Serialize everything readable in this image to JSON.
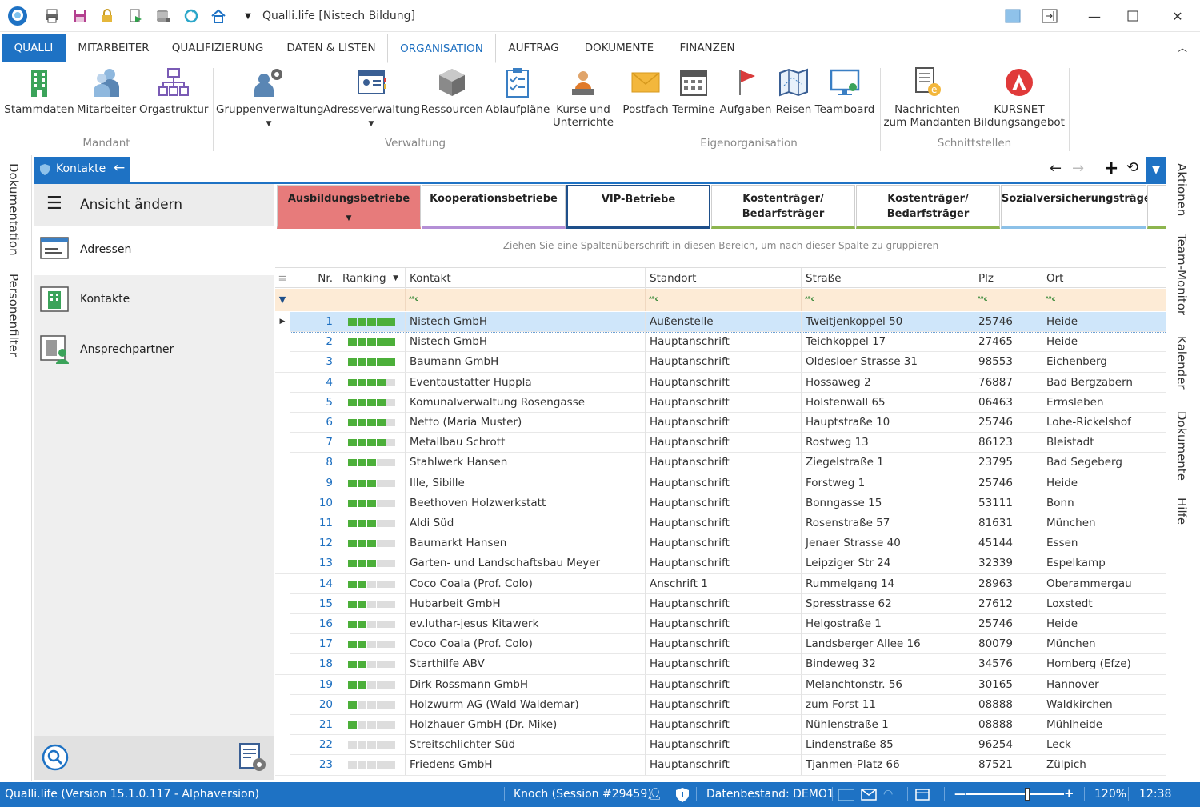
{
  "app": {
    "title": "Qualli.life [Nistech Bildung]"
  },
  "ribbon_tabs": [
    "QUALLI",
    "MITARBEITER",
    "QUALIFIZIERUNG",
    "DATEN & LISTEN",
    "ORGANISATION",
    "AUFTRAG",
    "DOKUMENTE",
    "FINANZEN"
  ],
  "ribbon": {
    "buttons": [
      {
        "label": "Stammdaten",
        "icon": "building-icon"
      },
      {
        "label": "Mitarbeiter",
        "icon": "employees-icon"
      },
      {
        "label": "Orgastruktur",
        "icon": "org-chart-icon"
      },
      {
        "label": "Gruppenverwaltung",
        "icon": "group-gear-icon"
      },
      {
        "label": "Adressverwaltung",
        "icon": "address-book-icon"
      },
      {
        "label": "Ressourcen",
        "icon": "cube-icon"
      },
      {
        "label": "Ablaufpläne",
        "icon": "checklist-icon"
      },
      {
        "label": "Kurse und Unterrichte",
        "icon": "teacher-icon"
      },
      {
        "label": "Postfach",
        "icon": "envelope-icon"
      },
      {
        "label": "Termine",
        "icon": "calendar-icon"
      },
      {
        "label": "Aufgaben",
        "icon": "flag-icon"
      },
      {
        "label": "Reisen",
        "icon": "map-icon"
      },
      {
        "label": "Teamboard",
        "icon": "monitor-icon"
      },
      {
        "label": "Nachrichten zum Mandanten",
        "icon": "message-doc-icon"
      },
      {
        "label": "KURSNET Bildungsangebot",
        "icon": "arbeitsagentur-icon"
      }
    ],
    "groups": [
      "Mandant",
      "Verwaltung",
      "Eigenorganisation",
      "Schnittstellen"
    ]
  },
  "side_left": [
    "Dokumentation",
    "Personenfilter"
  ],
  "side_right": [
    "Aktionen",
    "Team-Monitor",
    "Kalender",
    "Dokumente",
    "Hilfe"
  ],
  "doc_tab": {
    "label": "Kontakte"
  },
  "nav": {
    "title": "Ansicht ändern",
    "items": [
      "Adressen",
      "Kontakte",
      "Ansprechpartner"
    ]
  },
  "tiles": [
    {
      "label": "Ausbildungsbetriebe",
      "color": "#e77b7b",
      "bar": "#e77b7b"
    },
    {
      "label": "Kooperationsbetriebe",
      "color": "#ffffff",
      "bar": "#b48fd6"
    },
    {
      "label": "VIP-Betriebe",
      "color": "#ffffff",
      "bar": "#1e4f8a"
    },
    {
      "label": "Kostenträger/ Bedarfsträger",
      "color": "#ffffff",
      "bar": "#8db54e"
    },
    {
      "label": "Kostenträger/ Bedarfsträger",
      "color": "#ffffff",
      "bar": "#8db54e"
    },
    {
      "label": "Sozialversicherungsträger",
      "color": "#ffffff",
      "bar": "#8cc1e8"
    }
  ],
  "grid": {
    "group_hint": "Ziehen Sie eine Spaltenüberschrift in diesen Bereich, um nach dieser Spalte zu gruppieren",
    "columns": [
      "Nr.",
      "Ranking",
      "Kontakt",
      "Standort",
      "Straße",
      "Plz",
      "Ort"
    ],
    "filter_glyph": "ᴬᴮc",
    "rows": [
      {
        "nr": "1",
        "rank": 5,
        "kontakt": "Nistech GmbH",
        "standort": "Außenstelle",
        "strasse": "Tweitjenkoppel 50",
        "plz": "25746",
        "ort": "Heide"
      },
      {
        "nr": "2",
        "rank": 5,
        "kontakt": "Nistech GmbH",
        "standort": "Hauptanschrift",
        "strasse": "Teichkoppel 17",
        "plz": "27465",
        "ort": "Heide"
      },
      {
        "nr": "3",
        "rank": 5,
        "kontakt": "Baumann GmbH",
        "standort": "Hauptanschrift",
        "strasse": "Oldesloer Strasse  31",
        "plz": "98553",
        "ort": "Eichenberg"
      },
      {
        "nr": "4",
        "rank": 4,
        "kontakt": "Eventaustatter Huppla",
        "standort": "Hauptanschrift",
        "strasse": "Hossaweg 2",
        "plz": "76887",
        "ort": "Bad Bergzabern"
      },
      {
        "nr": "5",
        "rank": 4,
        "kontakt": "Komunalverwaltung Rosengasse",
        "standort": "Hauptanschrift",
        "strasse": "Holstenwall  65",
        "plz": "06463",
        "ort": "Ermsleben"
      },
      {
        "nr": "6",
        "rank": 4,
        "kontakt": "Netto (Maria Muster)",
        "standort": "Hauptanschrift",
        "strasse": "Hauptstraße 10",
        "plz": "25746",
        "ort": "Lohe-Rickelshof"
      },
      {
        "nr": "7",
        "rank": 4,
        "kontakt": "Metallbau Schrott",
        "standort": "Hauptanschrift",
        "strasse": "Rostweg 13",
        "plz": "86123",
        "ort": "Bleistadt"
      },
      {
        "nr": "8",
        "rank": 3,
        "kontakt": "Stahlwerk Hansen",
        "standort": "Hauptanschrift",
        "strasse": "Ziegelstraße 1",
        "plz": "23795",
        "ort": "Bad Segeberg"
      },
      {
        "nr": "9",
        "rank": 3,
        "kontakt": "Ille, Sibille",
        "standort": "Hauptanschrift",
        "strasse": "Forstweg  1",
        "plz": "25746",
        "ort": "Heide"
      },
      {
        "nr": "10",
        "rank": 3,
        "kontakt": "Beethoven Holzwerkstatt",
        "standort": "Hauptanschrift",
        "strasse": "Bonngasse 15",
        "plz": "53111",
        "ort": "Bonn"
      },
      {
        "nr": "11",
        "rank": 3,
        "kontakt": "Aldi Süd",
        "standort": "Hauptanschrift",
        "strasse": "Rosenstraße 57",
        "plz": "81631",
        "ort": "München"
      },
      {
        "nr": "12",
        "rank": 3,
        "kontakt": "Baumarkt Hansen",
        "standort": "Hauptanschrift",
        "strasse": "Jenaer Strasse  40",
        "plz": "45144",
        "ort": "Essen"
      },
      {
        "nr": "13",
        "rank": 3,
        "kontakt": "Garten- und Landschaftsbau Meyer",
        "standort": "Hauptanschrift",
        "strasse": "Leipziger Str 24",
        "plz": "32339",
        "ort": "Espelkamp"
      },
      {
        "nr": "14",
        "rank": 2,
        "kontakt": "Coco Coala (Prof. Colo)",
        "standort": "Anschrift 1",
        "strasse": "Rummelgang 14",
        "plz": "28963",
        "ort": "Oberammergau"
      },
      {
        "nr": "15",
        "rank": 2,
        "kontakt": "Hubarbeit GmbH",
        "standort": "Hauptanschrift",
        "strasse": "Spresstrasse 62",
        "plz": "27612",
        "ort": "Loxstedt"
      },
      {
        "nr": "16",
        "rank": 2,
        "kontakt": "ev.luthar-jesus Kitawerk",
        "standort": "Hauptanschrift",
        "strasse": "Helgostraße  1",
        "plz": "25746",
        "ort": "Heide"
      },
      {
        "nr": "17",
        "rank": 2,
        "kontakt": "Coco Coala (Prof. Colo)",
        "standort": "Hauptanschrift",
        "strasse": "Landsberger Allee 16",
        "plz": "80079",
        "ort": "München"
      },
      {
        "nr": "18",
        "rank": 2,
        "kontakt": "Starthilfe ABV",
        "standort": "Hauptanschrift",
        "strasse": "Bindeweg 32",
        "plz": "34576",
        "ort": "Homberg (Efze)"
      },
      {
        "nr": "19",
        "rank": 2,
        "kontakt": "Dirk Rossmann GmbH",
        "standort": "Hauptanschrift",
        "strasse": "Melanchtonstr. 56",
        "plz": "30165",
        "ort": "Hannover"
      },
      {
        "nr": "20",
        "rank": 1,
        "kontakt": "Holzwurm AG (Wald Waldemar)",
        "standort": "Hauptanschrift",
        "strasse": "zum Forst 11",
        "plz": "08888",
        "ort": "Waldkirchen"
      },
      {
        "nr": "21",
        "rank": 1,
        "kontakt": "Holzhauer GmbH (Dr. Mike)",
        "standort": "Hauptanschrift",
        "strasse": "Nühlenstraße 1",
        "plz": "08888",
        "ort": "Mühlheide"
      },
      {
        "nr": "22",
        "rank": 0,
        "kontakt": "Streitschlichter Süd",
        "standort": "Hauptanschrift",
        "strasse": "Lindenstraße 85",
        "plz": "96254",
        "ort": "Leck"
      },
      {
        "nr": "23",
        "rank": 0,
        "kontakt": "Friedens GmbH",
        "standort": "Hauptanschrift",
        "strasse": "Tjanmen-Platz 66",
        "plz": "87521",
        "ort": "Zülpich"
      }
    ]
  },
  "status": {
    "version": "Qualli.life (Version 15.1.0.117 - Alphaversion)",
    "session": "Knoch (Session #29459)",
    "datastore": "Datenbestand: DEMO1",
    "zoom": "120%",
    "time": "12:38",
    "zoom_level": 0.62
  },
  "colors": {
    "accent": "#1e72c4",
    "rank_on": "#4caf3a",
    "rank_off": "#dddddd",
    "selected_row": "#cfe6fa"
  }
}
